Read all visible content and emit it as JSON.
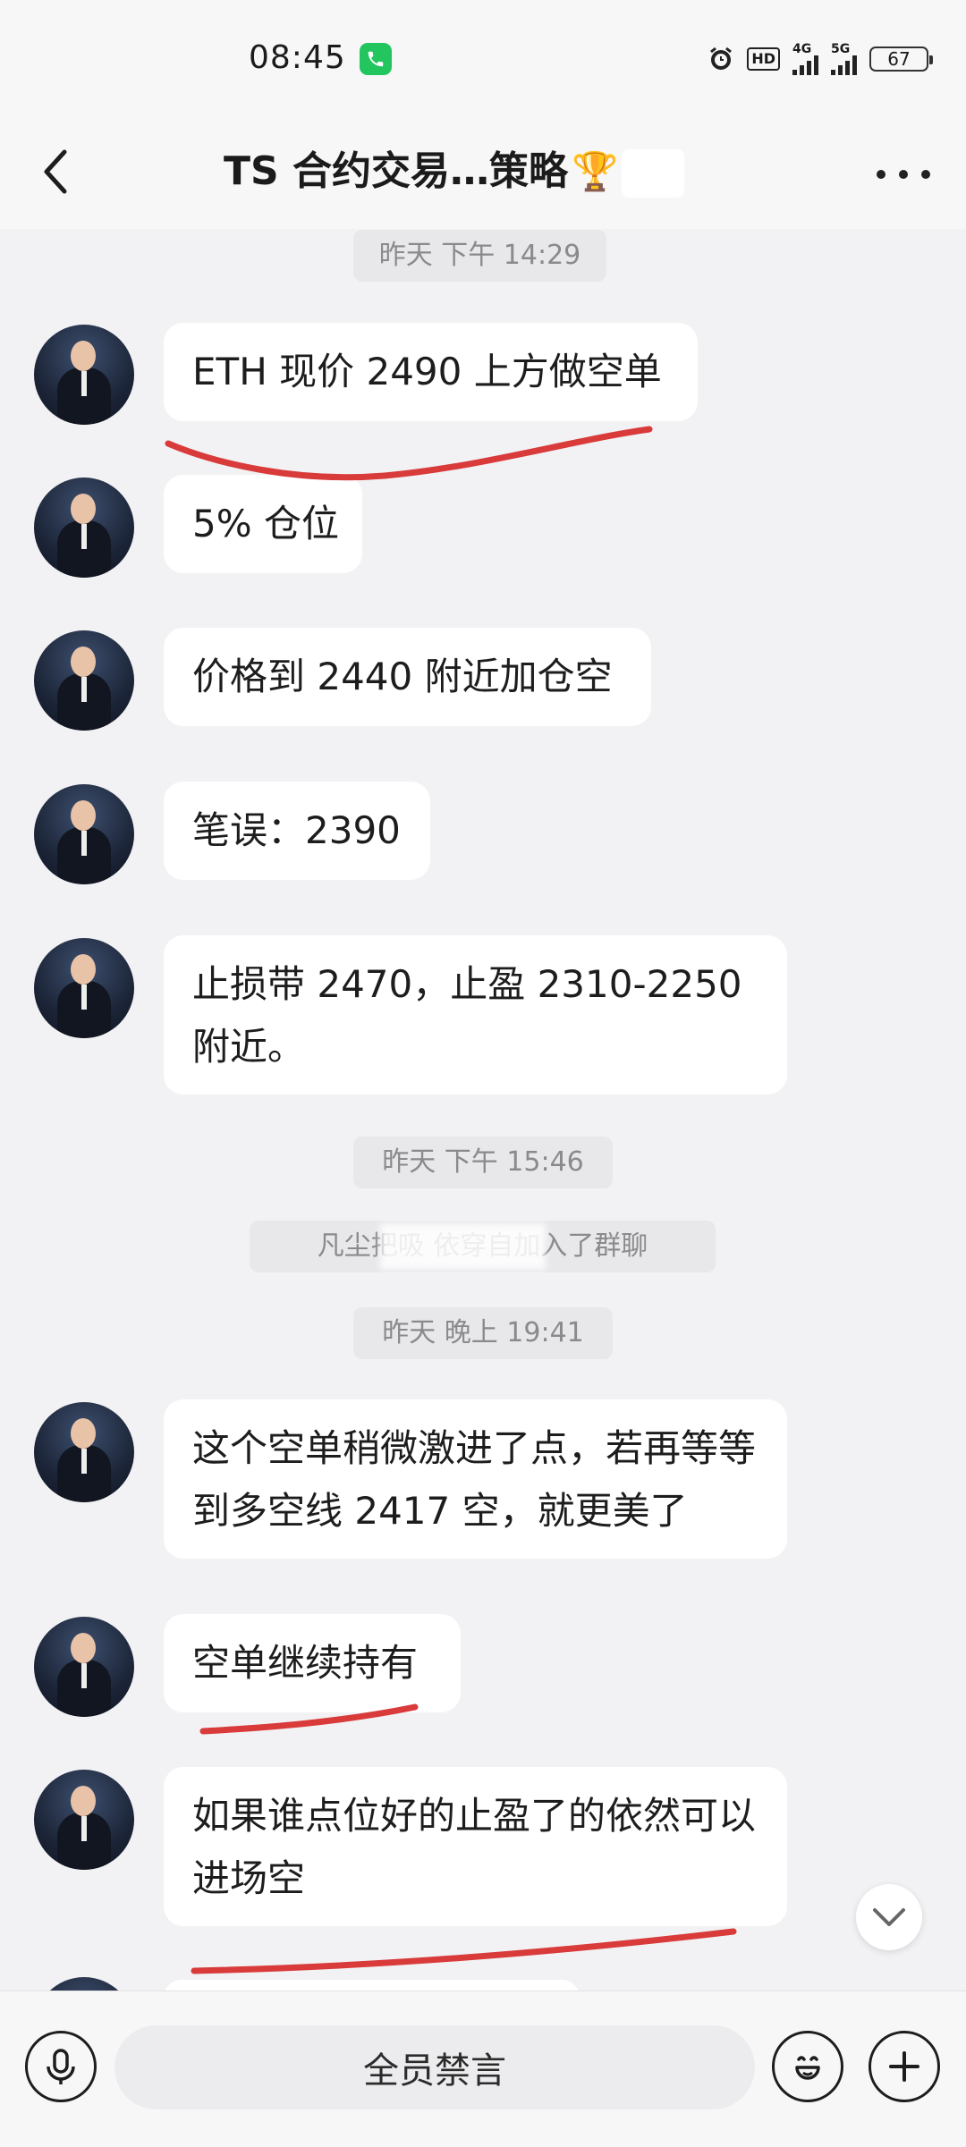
{
  "status_bar": {
    "time": "08:45",
    "call_icon": "phone-icon",
    "hd_label": "HD",
    "signal1_label": "4G",
    "signal2_label": "5G",
    "battery": "67",
    "call_color": "#22c55e"
  },
  "header": {
    "title": "TS 合约交易…策略",
    "title_emoji": "🏆"
  },
  "messages": [
    {
      "type": "time",
      "text": "昨天 下午 14:29"
    },
    {
      "type": "msg",
      "text": "ETH 现价 2490 上方做空单"
    },
    {
      "type": "msg",
      "text": "5% 仓位"
    },
    {
      "type": "msg",
      "text": "价格到 2440 附近加仓空"
    },
    {
      "type": "msg",
      "text": "笔误：2390"
    },
    {
      "type": "msg",
      "text": "止损带 2470，止盈 2310-2250附近。"
    },
    {
      "type": "time",
      "text": "昨天 下午 15:46"
    },
    {
      "type": "system",
      "text": "凡尘把吸     依穿自加入了群聊"
    },
    {
      "type": "time",
      "text": "昨天 晚上 19:41"
    },
    {
      "type": "msg",
      "text": "这个空单稍微激进了点，若再等等到多空线 2417 空，就更美了"
    },
    {
      "type": "msg",
      "text": "空单继续持有"
    },
    {
      "type": "msg",
      "text": "如果谁点位好的止盈了的依然可以进场空"
    }
  ],
  "bottom_bar": {
    "muted_label": "全员禁言"
  },
  "colors": {
    "annotation_red": "#d93a3a",
    "bubble_bg": "#ffffff",
    "chat_bg": "#f2f2f4"
  }
}
